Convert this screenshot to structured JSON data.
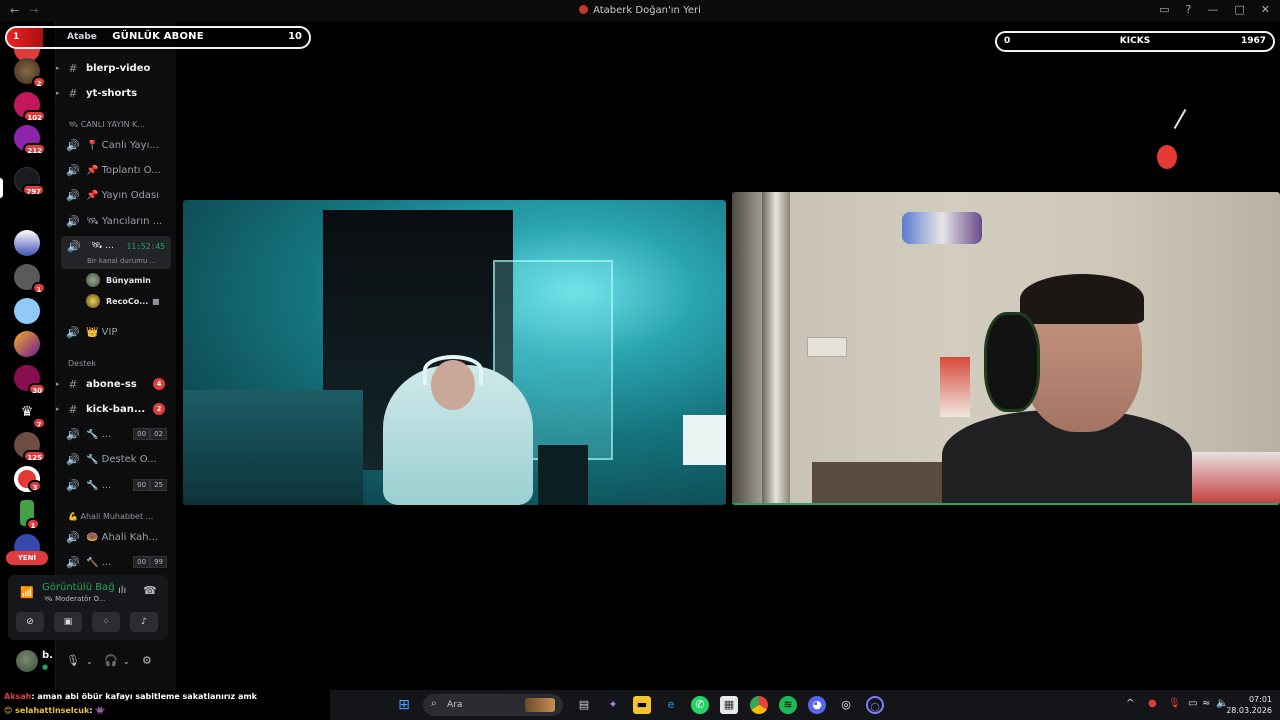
{
  "window": {
    "title": "Ataberk Doğan'ın Yeri",
    "back_glyph": "←",
    "forward_glyph": "→"
  },
  "overlays": {
    "daily_subs": {
      "count": "1",
      "label": "GÜNLÜK ABONE",
      "goal": "10",
      "behind_text": "Atabe"
    },
    "kicks": {
      "left": "0",
      "label": "KICKS",
      "right": "1967"
    }
  },
  "rail": {
    "badges": [
      "1",
      "2",
      "102",
      "212",
      "797",
      "1",
      "30",
      "7",
      "125",
      "3",
      "1"
    ],
    "new_label": "YENİ"
  },
  "channels": {
    "items": [
      {
        "icon": "#",
        "name": "blerp-video"
      },
      {
        "icon": "#",
        "name": "yt-shorts"
      },
      {
        "icon": "vol",
        "name": "📍 Canlı Yayı..."
      },
      {
        "icon": "vol",
        "name": "📌 Toplantı O..."
      },
      {
        "icon": "vol",
        "name": "📌 Yayın Odası"
      },
      {
        "icon": "vol",
        "name": "🛰 Yancıların ..."
      },
      {
        "icon": "vol",
        "name": "👑 VIP"
      },
      {
        "icon": "#",
        "name": "abone-ss",
        "count": "4"
      },
      {
        "icon": "#",
        "name": "kick-ban...",
        "count": "2"
      },
      {
        "icon": "vol",
        "name": "🔧 ...",
        "mini": [
          "00",
          "02"
        ]
      },
      {
        "icon": "vol",
        "name": "🔧 Destek O..."
      },
      {
        "icon": "vol",
        "name": "🔧 ...",
        "mini": [
          "00",
          "25"
        ]
      },
      {
        "icon": "vol",
        "name": "🍩 Ahali Kah..."
      },
      {
        "icon": "vol",
        "name": "🔨 ...",
        "mini": [
          "00",
          "99"
        ]
      }
    ],
    "categories": {
      "live": "🛰 CANLI YAYIN K...",
      "support": "Destek",
      "chat": "💪 Ahali Muhabbet ..."
    },
    "active": {
      "name": "🛰 ...",
      "time": "11:52:45",
      "sub": "Bir kanal durumu ..."
    },
    "members": [
      {
        "name": "Bünyamin"
      },
      {
        "name": "RecoCo..."
      }
    ]
  },
  "voice_panel": {
    "title": "Görüntülü Bağ",
    "subtitle": "🛰 Moderatör O...",
    "buttons": [
      "camera-off",
      "screen-share",
      "activities",
      "soundboard"
    ]
  },
  "user": {
    "name": "b.",
    "status": "●"
  },
  "chat_ticker": [
    {
      "user": "Aksah",
      "text": ": aman abi öbür kafayı sabitleme sakatlanırız amk"
    },
    {
      "user": "😊 selahattinselcuk",
      "text": ": 👾"
    }
  ],
  "taskbar": {
    "search_placeholder": "Ara",
    "clock_time": "07:01",
    "clock_date": "28.03.2026"
  },
  "colors": {
    "accent_green": "#23a55a",
    "badge_red": "#e03c3c",
    "teal_room": "#2aa5b0"
  }
}
